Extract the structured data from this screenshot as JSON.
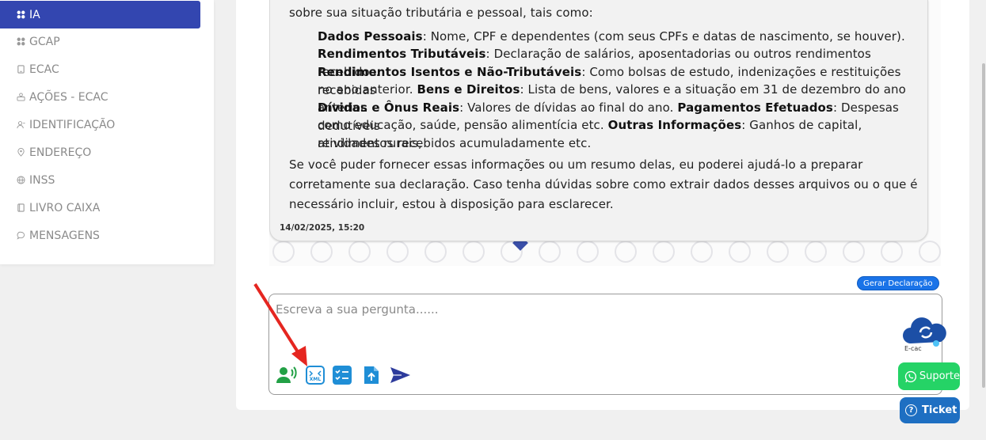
{
  "sidebar": {
    "items": [
      {
        "label": "IA",
        "icon": "apps-icon",
        "active": true
      },
      {
        "label": "GCAP",
        "icon": "apps-icon"
      },
      {
        "label": "ECAC",
        "icon": "tablet-icon"
      },
      {
        "label": "AÇÕES - ECAC",
        "icon": "people-icon"
      },
      {
        "label": "IDENTIFICAÇÃO",
        "icon": "person-icon"
      },
      {
        "label": "ENDEREÇO",
        "icon": "location-icon"
      },
      {
        "label": "INSS",
        "icon": "globe-icon"
      },
      {
        "label": "LIVRO CAIXA",
        "icon": "book-icon"
      },
      {
        "label": "MENSAGENS",
        "icon": "chat-icon"
      }
    ]
  },
  "chat": {
    "intro": "sobre sua situação tributária e pessoal, tais como:",
    "items": [
      {
        "title": "Dados Pessoais",
        "text": ": Nome, CPF e dependentes (com seus CPFs e datas de nascimento, se houver)."
      },
      {
        "title": "Rendimentos Tributáveis",
        "text": ": Declaração de salários, aposentadorias ou outros rendimentos recebidos."
      },
      {
        "title": "Rendimentos Isentos e Não-Tributáveis",
        "text": ": Como bolsas de estudo, indenizações e restituições recebidas"
      },
      {
        "line4_prefix": "no ano anterior. ",
        "title": "Bens e Direitos",
        "text": ": Lista de bens, valores e a situação em 31 de dezembro do ano anterior."
      },
      {
        "title": "Dívidas e Ônus Reais",
        "text": ": Valores de dívidas ao final do ano. "
      },
      {
        "title": "Pagamentos Efetuados",
        "text": ": Despesas dedutíveis"
      },
      {
        "line7_prefix": "como educação, saúde, pensão alimentícia etc. ",
        "title": "Outras Informações",
        "text": ": Ganhos de capital, atividades rurais,"
      },
      {
        "line8": "rendimentos recebidos acumuladamente etc."
      }
    ],
    "outro_lines": [
      "Se você puder fornecer essas informações ou um resumo delas, eu poderei ajudá-lo a preparar",
      "corretamente sua declaração. Caso tenha dúvidas sobre como extrair dados desses arquivos ou o que é",
      "necessário incluir, estou à disposição para esclarecer."
    ],
    "timestamp": "14/02/2025, 15:20"
  },
  "actions": {
    "gerar_label": "Gerar Declaração",
    "input_placeholder": "Escreva a sua pergunta......",
    "tools": [
      "voice-icon",
      "xml-upload-icon",
      "checklist-icon",
      "file-upload-icon",
      "send-icon"
    ]
  },
  "floating": {
    "ecac_label": "E-cac",
    "suporte_label": "Suporte",
    "ticket_label": "Ticket"
  },
  "colors": {
    "accent": "#3346b0",
    "whatsapp": "#25d366",
    "ticket": "#1e6fc2",
    "annotation_arrow": "#e52620"
  }
}
